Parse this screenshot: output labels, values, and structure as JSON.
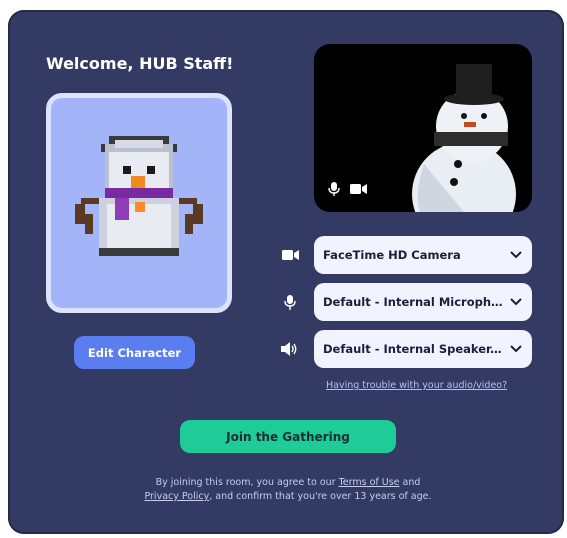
{
  "welcome": {
    "title": "Welcome, HUB Staff!"
  },
  "avatar": {
    "edit_label": "Edit Character"
  },
  "preview": {
    "mic_icon": "microphone-icon",
    "camera_icon": "camera-icon"
  },
  "devices": {
    "camera": {
      "value": "FaceTime HD Camera",
      "icon": "camera-icon"
    },
    "microphone": {
      "value": "Default - Internal Microph...",
      "icon": "microphone-icon"
    },
    "speaker": {
      "value": "Default - Internal Speaker...",
      "icon": "speaker-icon"
    }
  },
  "help": {
    "label": "Having trouble with your audio/video?"
  },
  "join": {
    "label": "Join the Gathering"
  },
  "legal": {
    "prefix": "By joining this room, you agree to our",
    "terms": "Terms of Use",
    "and": "and",
    "privacy": "Privacy Policy",
    "suffix": ", and confirm that you're over 13 years of age."
  },
  "colors": {
    "panel": "#333a64",
    "accent": "#5a7ef0",
    "join": "#1dcc96",
    "avatar_bg": "#a3b4f9"
  }
}
